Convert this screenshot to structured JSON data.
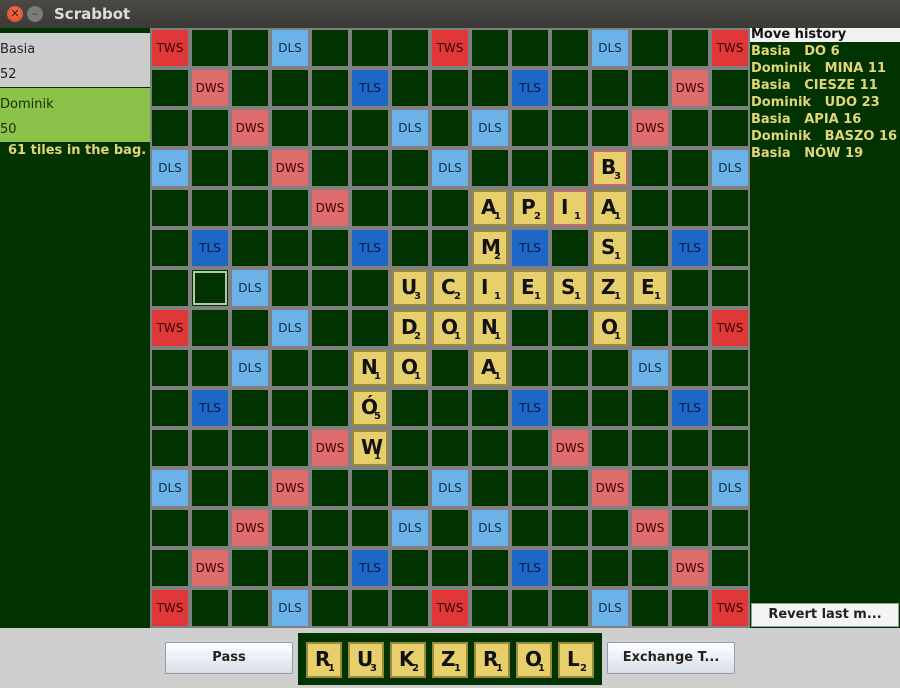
{
  "window": {
    "title": "Scrabbot"
  },
  "players": [
    {
      "name": "Basia",
      "score": "52"
    },
    {
      "name": "Dominik",
      "score": "50"
    }
  ],
  "bag_text": "61 tiles in the bag.",
  "history": {
    "title": "Move history",
    "moves": [
      "Basia   DO 6",
      "Dominik   MINA 11",
      "Basia   CIESZE 11",
      "Dominik   UDO 23",
      "Basia   APIA 16",
      "Dominik   BASZO 16",
      "Basia   NÓW 19"
    ],
    "revert_label": "Revert last m..."
  },
  "board": {
    "rows": [
      "T..D...T...D..T",
      ".W...S...S...W.",
      "..W...D.D...W..",
      "D..W...D...W..D",
      "....W.....W....",
      ".S...S...S...S.",
      "..D...D.D...D..",
      "T..D...W...D..T",
      "..D...D.D...D..",
      ".S...S...S...S.",
      "....W.....W....",
      "D..W...D...W..D",
      "..W...D.D...W..",
      ".W...S...S...W.",
      "T..D...T...D..T"
    ],
    "premium_labels": {
      "T": "TWS",
      "W": "DWS",
      "S": "TLS",
      "D": "DLS"
    },
    "cursor": {
      "row": 6,
      "col": 1
    },
    "tiles": [
      {
        "row": 3,
        "col": 11,
        "letter": "B",
        "points": "3",
        "last": true
      },
      {
        "row": 4,
        "col": 8,
        "letter": "A",
        "points": "1"
      },
      {
        "row": 4,
        "col": 9,
        "letter": "P",
        "points": "2"
      },
      {
        "row": 4,
        "col": 10,
        "letter": "I",
        "points": "1",
        "last": true
      },
      {
        "row": 4,
        "col": 11,
        "letter": "A",
        "points": "1"
      },
      {
        "row": 5,
        "col": 8,
        "letter": "M",
        "points": "2"
      },
      {
        "row": 5,
        "col": 11,
        "letter": "S",
        "points": "1"
      },
      {
        "row": 6,
        "col": 6,
        "letter": "U",
        "points": "3"
      },
      {
        "row": 6,
        "col": 7,
        "letter": "C",
        "points": "2"
      },
      {
        "row": 6,
        "col": 8,
        "letter": "I",
        "points": "1"
      },
      {
        "row": 6,
        "col": 9,
        "letter": "E",
        "points": "1"
      },
      {
        "row": 6,
        "col": 10,
        "letter": "S",
        "points": "1"
      },
      {
        "row": 6,
        "col": 11,
        "letter": "Z",
        "points": "1"
      },
      {
        "row": 6,
        "col": 12,
        "letter": "E",
        "points": "1"
      },
      {
        "row": 7,
        "col": 6,
        "letter": "D",
        "points": "2"
      },
      {
        "row": 7,
        "col": 7,
        "letter": "O",
        "points": "1"
      },
      {
        "row": 7,
        "col": 8,
        "letter": "N",
        "points": "1"
      },
      {
        "row": 7,
        "col": 11,
        "letter": "O",
        "points": "1"
      },
      {
        "row": 8,
        "col": 5,
        "letter": "N",
        "points": "1"
      },
      {
        "row": 8,
        "col": 6,
        "letter": "O",
        "points": "1"
      },
      {
        "row": 8,
        "col": 8,
        "letter": "A",
        "points": "1"
      },
      {
        "row": 9,
        "col": 5,
        "letter": "Ó",
        "points": "5"
      },
      {
        "row": 10,
        "col": 5,
        "letter": "W",
        "points": "1"
      }
    ]
  },
  "rack": [
    {
      "letter": "R",
      "points": "1"
    },
    {
      "letter": "U",
      "points": "3"
    },
    {
      "letter": "K",
      "points": "2"
    },
    {
      "letter": "Z",
      "points": "1"
    },
    {
      "letter": "R",
      "points": "1"
    },
    {
      "letter": "O",
      "points": "1"
    },
    {
      "letter": "L",
      "points": "2"
    }
  ],
  "buttons": {
    "pass": "Pass",
    "exchange": "Exchange T..."
  },
  "colors": {
    "background": "#003300",
    "tile": "#e7cf6b",
    "tws": "#e03838",
    "dws": "#e06d6d",
    "tls": "#1e67c6",
    "dls": "#6bb2e8",
    "active_player": "#8bc34a",
    "history_text": "#e3d57a"
  }
}
